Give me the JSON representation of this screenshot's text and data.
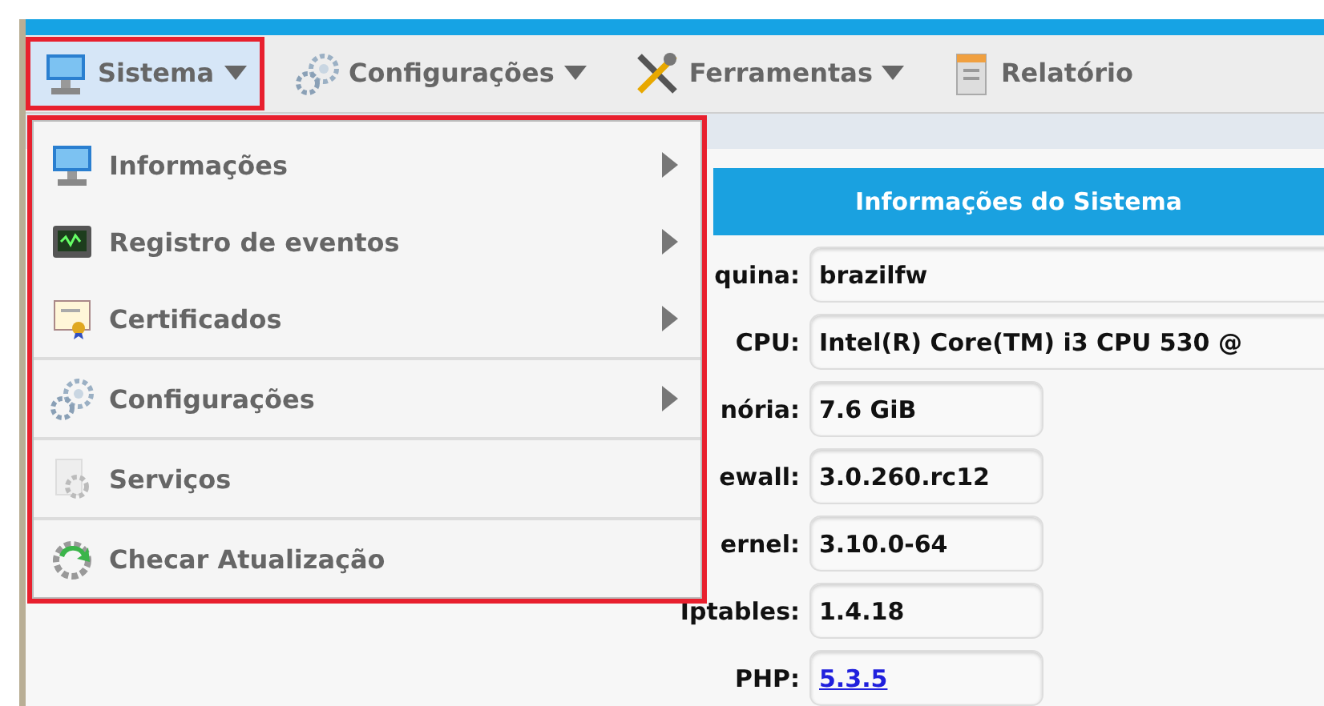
{
  "menubar": [
    {
      "label": "Sistema",
      "selected": true,
      "caret": true
    },
    {
      "label": "Configurações",
      "selected": false,
      "caret": true
    },
    {
      "label": "Ferramentas",
      "selected": false,
      "caret": true
    },
    {
      "label": "Relatório",
      "selected": false,
      "caret": false
    }
  ],
  "dropdown": {
    "sections": [
      [
        {
          "label": "Informações",
          "submenu": true
        },
        {
          "label": "Registro de eventos",
          "submenu": true
        },
        {
          "label": "Certificados",
          "submenu": true
        }
      ],
      [
        {
          "label": "Configurações",
          "submenu": true
        }
      ],
      [
        {
          "label": "Serviços",
          "submenu": false
        }
      ],
      [
        {
          "label": "Checar Atualização",
          "submenu": false
        }
      ]
    ]
  },
  "panel": {
    "title": "Informações do Sistema",
    "rows": [
      {
        "label": "quina:",
        "value": "brazilfw",
        "kind": "wide"
      },
      {
        "label": "CPU:",
        "value": "Intel(R) Core(TM) i3 CPU 530 @",
        "kind": "wide"
      },
      {
        "label": "nória:",
        "value": "7.6 GiB",
        "kind": "short"
      },
      {
        "label": "ewall:",
        "value": "3.0.260.rc12",
        "kind": "short"
      },
      {
        "label": "ernel:",
        "value": "3.10.0-64",
        "kind": "short"
      },
      {
        "label": "Iptables:",
        "value": "1.4.18",
        "kind": "short"
      },
      {
        "label": "PHP:",
        "value": "5.3.5",
        "kind": "link"
      }
    ]
  }
}
